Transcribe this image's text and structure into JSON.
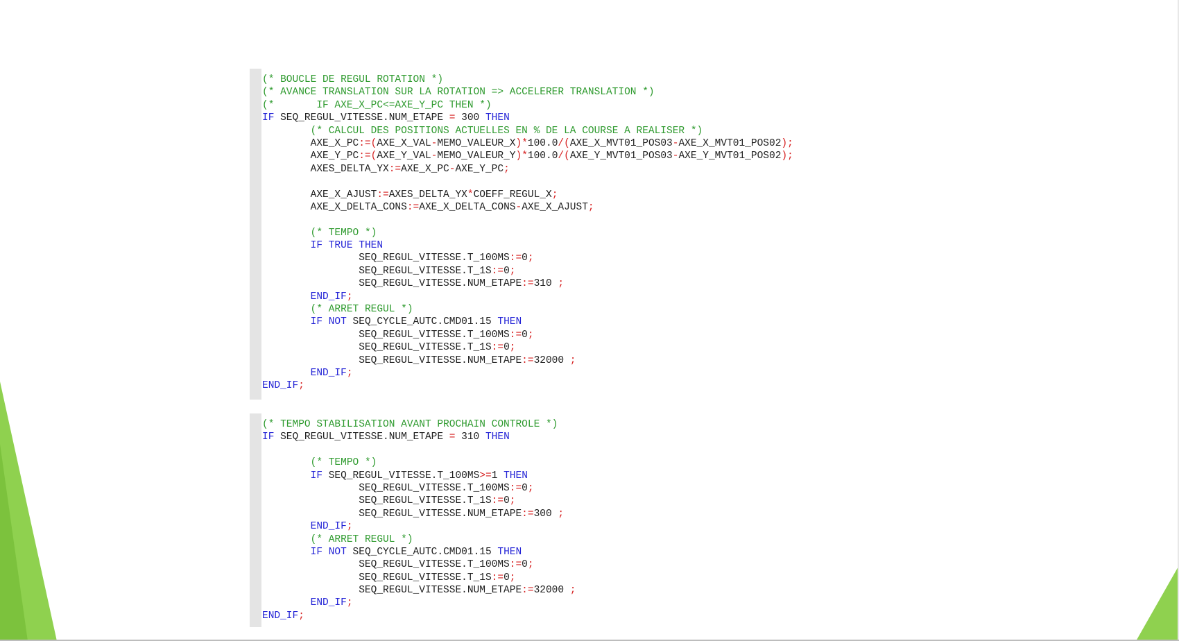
{
  "colors": {
    "comment": "#2e9a2e",
    "keyword": "#2323d6",
    "operator": "#d62020",
    "text": "#202020",
    "gutter": "#e4e4e4",
    "accent_green": "#8fd14f"
  },
  "blocks": [
    {
      "lines": [
        [
          [
            "cm",
            "(* BOUCLE DE REGUL ROTATION *)"
          ]
        ],
        [
          [
            "cm",
            "(* AVANCE TRANSLATION SUR LA ROTATION => ACCELERER TRANSLATION *)"
          ]
        ],
        [
          [
            "cm",
            "(*       IF AXE_X_PC<=AXE_Y_PC THEN *)"
          ]
        ],
        [
          [
            "kw",
            "IF"
          ],
          [
            "tx",
            " SEQ_REGUL_VITESSE.NUM_ETAPE "
          ],
          [
            "op",
            "="
          ],
          [
            "tx",
            " 300 "
          ],
          [
            "kw",
            "THEN"
          ]
        ],
        [
          [
            "tx",
            "        "
          ],
          [
            "cm",
            "(* CALCUL DES POSITIONS ACTUELLES EN % DE LA COURSE A REALISER *)"
          ]
        ],
        [
          [
            "tx",
            "        AXE_X_PC"
          ],
          [
            "op",
            ":=("
          ],
          [
            "tx",
            "AXE_X_VAL"
          ],
          [
            "op",
            "-"
          ],
          [
            "tx",
            "MEMO_VALEUR_X"
          ],
          [
            "op",
            ")*"
          ],
          [
            "tx",
            "100.0"
          ],
          [
            "op",
            "/("
          ],
          [
            "tx",
            "AXE_X_MVT01_POS03"
          ],
          [
            "op",
            "-"
          ],
          [
            "tx",
            "AXE_X_MVT01_POS02"
          ],
          [
            "op",
            ");"
          ]
        ],
        [
          [
            "tx",
            "        AXE_Y_PC"
          ],
          [
            "op",
            ":=("
          ],
          [
            "tx",
            "AXE_Y_VAL"
          ],
          [
            "op",
            "-"
          ],
          [
            "tx",
            "MEMO_VALEUR_Y"
          ],
          [
            "op",
            ")*"
          ],
          [
            "tx",
            "100.0"
          ],
          [
            "op",
            "/("
          ],
          [
            "tx",
            "AXE_Y_MVT01_POS03"
          ],
          [
            "op",
            "-"
          ],
          [
            "tx",
            "AXE_Y_MVT01_POS02"
          ],
          [
            "op",
            ");"
          ]
        ],
        [
          [
            "tx",
            "        AXES_DELTA_YX"
          ],
          [
            "op",
            ":="
          ],
          [
            "tx",
            "AXE_X_PC"
          ],
          [
            "op",
            "-"
          ],
          [
            "tx",
            "AXE_Y_PC"
          ],
          [
            "op",
            ";"
          ]
        ],
        [
          [
            "tx",
            ""
          ]
        ],
        [
          [
            "tx",
            "        AXE_X_AJUST"
          ],
          [
            "op",
            ":="
          ],
          [
            "tx",
            "AXES_DELTA_YX"
          ],
          [
            "op",
            "*"
          ],
          [
            "tx",
            "COEFF_REGUL_X"
          ],
          [
            "op",
            ";"
          ]
        ],
        [
          [
            "tx",
            "        AXE_X_DELTA_CONS"
          ],
          [
            "op",
            ":="
          ],
          [
            "tx",
            "AXE_X_DELTA_CONS"
          ],
          [
            "op",
            "-"
          ],
          [
            "tx",
            "AXE_X_AJUST"
          ],
          [
            "op",
            ";"
          ]
        ],
        [
          [
            "tx",
            ""
          ]
        ],
        [
          [
            "tx",
            "        "
          ],
          [
            "cm",
            "(* TEMPO *)"
          ]
        ],
        [
          [
            "tx",
            "        "
          ],
          [
            "kw",
            "IF TRUE THEN"
          ]
        ],
        [
          [
            "tx",
            "                SEQ_REGUL_VITESSE.T_100MS"
          ],
          [
            "op",
            ":="
          ],
          [
            "tx",
            "0"
          ],
          [
            "op",
            ";"
          ]
        ],
        [
          [
            "tx",
            "                SEQ_REGUL_VITESSE.T_1S"
          ],
          [
            "op",
            ":="
          ],
          [
            "tx",
            "0"
          ],
          [
            "op",
            ";"
          ]
        ],
        [
          [
            "tx",
            "                SEQ_REGUL_VITESSE.NUM_ETAPE"
          ],
          [
            "op",
            ":="
          ],
          [
            "tx",
            "310 "
          ],
          [
            "op",
            ";"
          ]
        ],
        [
          [
            "tx",
            "        "
          ],
          [
            "kw",
            "END_IF"
          ],
          [
            "op",
            ";"
          ]
        ],
        [
          [
            "tx",
            "        "
          ],
          [
            "cm",
            "(* ARRET REGUL *)"
          ]
        ],
        [
          [
            "tx",
            "        "
          ],
          [
            "kw",
            "IF NOT"
          ],
          [
            "tx",
            " SEQ_CYCLE_AUTC.CMD01.15 "
          ],
          [
            "kw",
            "THEN"
          ]
        ],
        [
          [
            "tx",
            "                SEQ_REGUL_VITESSE.T_100MS"
          ],
          [
            "op",
            ":="
          ],
          [
            "tx",
            "0"
          ],
          [
            "op",
            ";"
          ]
        ],
        [
          [
            "tx",
            "                SEQ_REGUL_VITESSE.T_1S"
          ],
          [
            "op",
            ":="
          ],
          [
            "tx",
            "0"
          ],
          [
            "op",
            ";"
          ]
        ],
        [
          [
            "tx",
            "                SEQ_REGUL_VITESSE.NUM_ETAPE"
          ],
          [
            "op",
            ":="
          ],
          [
            "tx",
            "32000 "
          ],
          [
            "op",
            ";"
          ]
        ],
        [
          [
            "tx",
            "        "
          ],
          [
            "kw",
            "END_IF"
          ],
          [
            "op",
            ";"
          ]
        ],
        [
          [
            "kw",
            "END_IF"
          ],
          [
            "op",
            ";"
          ]
        ]
      ]
    },
    {
      "lines": [
        [
          [
            "cm",
            "(* TEMPO STABILISATION AVANT PROCHAIN CONTROLE *)"
          ]
        ],
        [
          [
            "kw",
            "IF"
          ],
          [
            "tx",
            " SEQ_REGUL_VITESSE.NUM_ETAPE "
          ],
          [
            "op",
            "="
          ],
          [
            "tx",
            " 310 "
          ],
          [
            "kw",
            "THEN"
          ]
        ],
        [
          [
            "tx",
            ""
          ]
        ],
        [
          [
            "tx",
            "        "
          ],
          [
            "cm",
            "(* TEMPO *)"
          ]
        ],
        [
          [
            "tx",
            "        "
          ],
          [
            "kw",
            "IF"
          ],
          [
            "tx",
            " SEQ_REGUL_VITESSE.T_100MS"
          ],
          [
            "op",
            ">="
          ],
          [
            "tx",
            "1 "
          ],
          [
            "kw",
            "THEN"
          ]
        ],
        [
          [
            "tx",
            "                SEQ_REGUL_VITESSE.T_100MS"
          ],
          [
            "op",
            ":="
          ],
          [
            "tx",
            "0"
          ],
          [
            "op",
            ";"
          ]
        ],
        [
          [
            "tx",
            "                SEQ_REGUL_VITESSE.T_1S"
          ],
          [
            "op",
            ":="
          ],
          [
            "tx",
            "0"
          ],
          [
            "op",
            ";"
          ]
        ],
        [
          [
            "tx",
            "                SEQ_REGUL_VITESSE.NUM_ETAPE"
          ],
          [
            "op",
            ":="
          ],
          [
            "tx",
            "300 "
          ],
          [
            "op",
            ";"
          ]
        ],
        [
          [
            "tx",
            "        "
          ],
          [
            "kw",
            "END_IF"
          ],
          [
            "op",
            ";"
          ]
        ],
        [
          [
            "tx",
            "        "
          ],
          [
            "cm",
            "(* ARRET REGUL *)"
          ]
        ],
        [
          [
            "tx",
            "        "
          ],
          [
            "kw",
            "IF NOT"
          ],
          [
            "tx",
            " SEQ_CYCLE_AUTC.CMD01.15 "
          ],
          [
            "kw",
            "THEN"
          ]
        ],
        [
          [
            "tx",
            "                SEQ_REGUL_VITESSE.T_100MS"
          ],
          [
            "op",
            ":="
          ],
          [
            "tx",
            "0"
          ],
          [
            "op",
            ";"
          ]
        ],
        [
          [
            "tx",
            "                SEQ_REGUL_VITESSE.T_1S"
          ],
          [
            "op",
            ":="
          ],
          [
            "tx",
            "0"
          ],
          [
            "op",
            ";"
          ]
        ],
        [
          [
            "tx",
            "                SEQ_REGUL_VITESSE.NUM_ETAPE"
          ],
          [
            "op",
            ":="
          ],
          [
            "tx",
            "32000 "
          ],
          [
            "op",
            ";"
          ]
        ],
        [
          [
            "tx",
            "        "
          ],
          [
            "kw",
            "END_IF"
          ],
          [
            "op",
            ";"
          ]
        ],
        [
          [
            "kw",
            "END_IF"
          ],
          [
            "op",
            ";"
          ]
        ]
      ]
    }
  ]
}
